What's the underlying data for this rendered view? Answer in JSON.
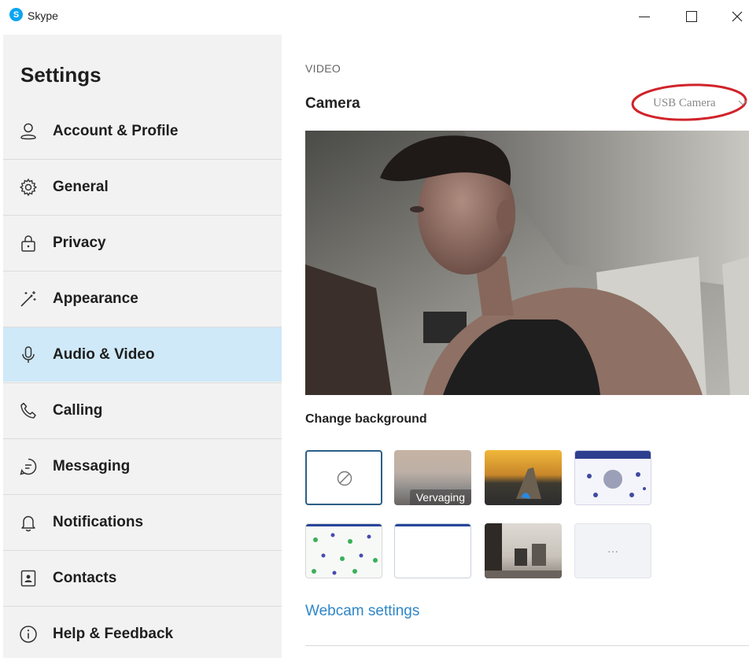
{
  "window": {
    "app_title": "Skype",
    "logo_letter": "S",
    "brand_color": "#0aa5f0"
  },
  "sidebar": {
    "heading": "Settings",
    "active_color": "#cfe9f8",
    "items": [
      {
        "label": "Account & Profile",
        "icon": "person-icon"
      },
      {
        "label": "General",
        "icon": "gear-icon"
      },
      {
        "label": "Privacy",
        "icon": "lock-icon"
      },
      {
        "label": "Appearance",
        "icon": "magic-wand-icon"
      },
      {
        "label": "Audio & Video",
        "icon": "microphone-icon",
        "active": true
      },
      {
        "label": "Calling",
        "icon": "phone-icon"
      },
      {
        "label": "Messaging",
        "icon": "chat-bubble-icon"
      },
      {
        "label": "Notifications",
        "icon": "bell-icon"
      },
      {
        "label": "Contacts",
        "icon": "contact-card-icon"
      },
      {
        "label": "Help & Feedback",
        "icon": "info-icon"
      }
    ]
  },
  "video": {
    "section_label": "VIDEO",
    "camera_label": "Camera",
    "camera_selected": "USB Camera",
    "change_background_label": "Change background",
    "backgrounds": [
      {
        "kind": "none",
        "icon": "no-background-icon",
        "selected": true
      },
      {
        "kind": "blur",
        "label": "Vervaging"
      },
      {
        "kind": "image",
        "name": "sunset-hand"
      },
      {
        "kind": "image",
        "name": "floral-pattern"
      },
      {
        "kind": "image",
        "name": "green-dots"
      },
      {
        "kind": "image",
        "name": "white-plain"
      },
      {
        "kind": "image",
        "name": "room"
      },
      {
        "kind": "more",
        "label": "···"
      }
    ],
    "webcam_settings_link": "Webcam settings",
    "link_color": "#2e86c8",
    "highlight_color": "#d0232a"
  }
}
